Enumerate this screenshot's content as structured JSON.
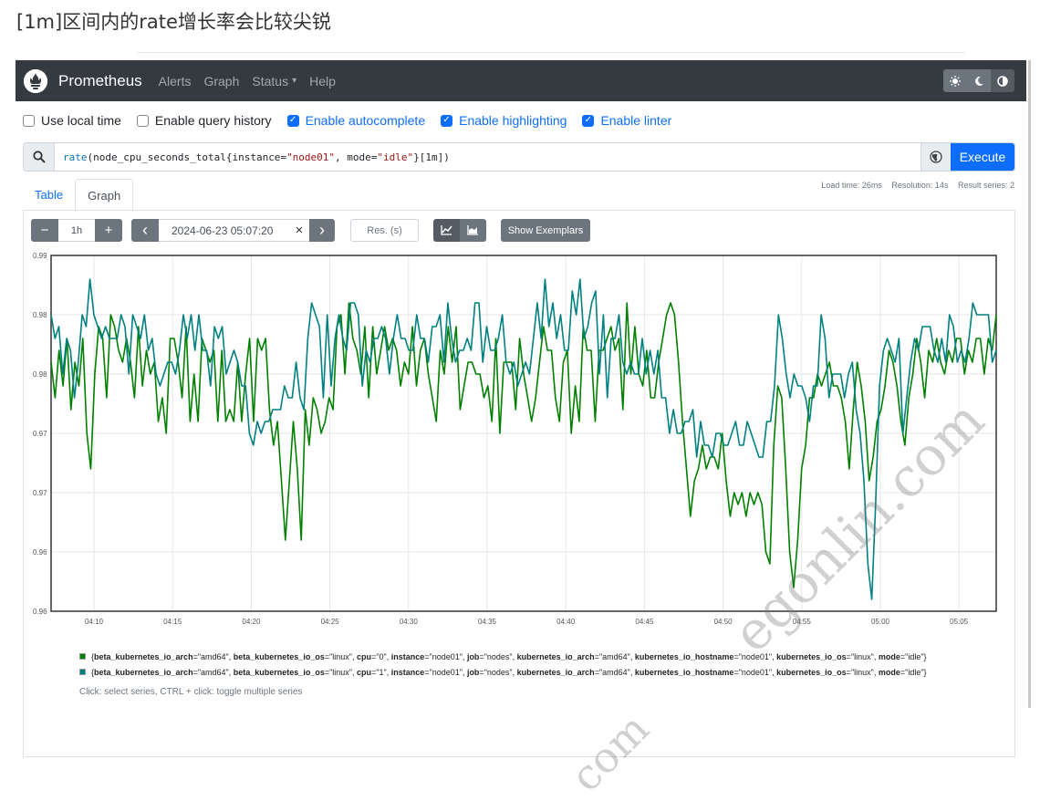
{
  "heading": "[1m]区间内的rate增长率会比较尖锐",
  "navbar": {
    "brand": "Prometheus",
    "links": [
      "Alerts",
      "Graph",
      "Status",
      "Help"
    ],
    "status_caret": "▾",
    "theme_icons": [
      "sun-icon",
      "moon-icon",
      "contrast-icon"
    ]
  },
  "options": [
    {
      "label": "Use local time",
      "checked": false
    },
    {
      "label": "Enable query history",
      "checked": false
    },
    {
      "label": "Enable autocomplete",
      "checked": true
    },
    {
      "label": "Enable highlighting",
      "checked": true
    },
    {
      "label": "Enable linter",
      "checked": true
    }
  ],
  "query": {
    "fn": "rate",
    "metric": "node_cpu_seconds_total",
    "label1_key": "instance",
    "label1_val": "\"node01\"",
    "label2_key": "mode",
    "label2_val": "\"idle\"",
    "range": "[1m]",
    "execute_label": "Execute"
  },
  "stats": {
    "load_time": "Load time: 26ms",
    "resolution": "Resolution: 14s",
    "result_series": "Result series: 2"
  },
  "tabs": [
    "Table",
    "Graph"
  ],
  "controls": {
    "minus": "−",
    "range": "1h",
    "plus": "+",
    "prev": "‹",
    "datetime": "2024-06-23 05:07:20",
    "clear": "×",
    "next": "›",
    "res_placeholder": "Res. (s)",
    "exemplars": "Show Exemplars"
  },
  "chart_data": {
    "type": "line",
    "x_ticks": [
      "04:10",
      "04:15",
      "04:20",
      "04:25",
      "04:30",
      "04:35",
      "04:40",
      "04:45",
      "04:50",
      "04:55",
      "05:00",
      "05:05"
    ],
    "y_ticks": [
      "0.99",
      "0.98",
      "0.98",
      "0.97",
      "0.97",
      "0.96",
      "0.96"
    ],
    "ylim": [
      0.96,
      0.99
    ],
    "grid": true,
    "series": [
      {
        "color": "#008000",
        "values": [
          0.981,
          0.978,
          0.982,
          0.979,
          0.983,
          0.977,
          0.981,
          0.979,
          0.983,
          0.975,
          0.972,
          0.98,
          0.984,
          0.983,
          0.978,
          0.985,
          0.984,
          0.982,
          0.981,
          0.983,
          0.981,
          0.978,
          0.984,
          0.979,
          0.982,
          0.98,
          0.981,
          0.976,
          0.978,
          0.975,
          0.983,
          0.983,
          0.981,
          0.978,
          0.984,
          0.976,
          0.98,
          0.976,
          0.983,
          0.982,
          0.981,
          0.982,
          0.976,
          0.982,
          0.976,
          0.977,
          0.976,
          0.981,
          0.976,
          0.98,
          0.983,
          0.976,
          0.983,
          0.982,
          0.983,
          0.977,
          0.974,
          0.976,
          0.971,
          0.966,
          0.971,
          0.976,
          0.972,
          0.966,
          0.977,
          0.974,
          0.978,
          0.977,
          0.975,
          0.976,
          0.978,
          0.977,
          0.984,
          0.985,
          0.98,
          0.986,
          0.983,
          0.982,
          0.98,
          0.984,
          0.978,
          0.984,
          0.98,
          0.982,
          0.984,
          0.982,
          0.983,
          0.982,
          0.979,
          0.981,
          0.98,
          0.984,
          0.979,
          0.982,
          0.983,
          0.98,
          0.978,
          0.976,
          0.982,
          0.98,
          0.984,
          0.981,
          0.984,
          0.977,
          0.979,
          0.981,
          0.981,
          0.98,
          0.98,
          0.978,
          0.979,
          0.976,
          0.983,
          0.975,
          0.981,
          0.981,
          0.981,
          0.977,
          0.983,
          0.98,
          0.978,
          0.976,
          0.978,
          0.981,
          0.984,
          0.982,
          0.982,
          0.978,
          0.976,
          0.981,
          0.982,
          0.975,
          0.979,
          0.976,
          0.984,
          0.982,
          0.982,
          0.976,
          0.982,
          0.982,
          0.983,
          0.984,
          0.982,
          0.983,
          0.977,
          0.986,
          0.98,
          0.984,
          0.98,
          0.979,
          0.982,
          0.978,
          0.978,
          0.981,
          0.983,
          0.985,
          0.986,
          0.985,
          0.981,
          0.976,
          0.972,
          0.968,
          0.971,
          0.972,
          0.974,
          0.972,
          0.973,
          0.973,
          0.972,
          0.975,
          0.971,
          0.968,
          0.97,
          0.969,
          0.97,
          0.968,
          0.97,
          0.969,
          0.97,
          0.969,
          0.965,
          0.964,
          0.974,
          0.979,
          0.978,
          0.972,
          0.965,
          0.962,
          0.966,
          0.972,
          0.974,
          0.978,
          0.978,
          0.98,
          0.979,
          0.98,
          0.981,
          0.979,
          0.979,
          0.978,
          0.976,
          0.972,
          0.977,
          0.981,
          0.979,
          0.976,
          0.971,
          0.973,
          0.976,
          0.977,
          0.979,
          0.982,
          0.981,
          0.979,
          0.976,
          0.974,
          0.978,
          0.98,
          0.983,
          0.981,
          0.978,
          0.982,
          0.981,
          0.983,
          0.981,
          0.98,
          0.982,
          0.981,
          0.983,
          0.983,
          0.98,
          0.982,
          0.981,
          0.983,
          0.983,
          0.98,
          0.983,
          0.982,
          0.985
        ]
      },
      {
        "color": "#008080",
        "values": [
          0.985,
          0.983,
          0.984,
          0.98,
          0.983,
          0.982,
          0.978,
          0.981,
          0.985,
          0.984,
          0.988,
          0.985,
          0.984,
          0.983,
          0.984,
          0.983,
          0.983,
          0.983,
          0.985,
          0.984,
          0.98,
          0.985,
          0.984,
          0.983,
          0.985,
          0.982,
          0.983,
          0.98,
          0.979,
          0.98,
          0.981,
          0.981,
          0.98,
          0.982,
          0.985,
          0.983,
          0.985,
          0.982,
          0.985,
          0.982,
          0.982,
          0.979,
          0.984,
          0.983,
          0.984,
          0.98,
          0.981,
          0.982,
          0.981,
          0.979,
          0.979,
          0.975,
          0.974,
          0.976,
          0.975,
          0.976,
          0.976,
          0.977,
          0.977,
          0.977,
          0.979,
          0.978,
          0.978,
          0.981,
          0.978,
          0.977,
          0.983,
          0.986,
          0.985,
          0.984,
          0.978,
          0.985,
          0.979,
          0.983,
          0.985,
          0.983,
          0.982,
          0.986,
          0.986,
          0.985,
          0.979,
          0.982,
          0.981,
          0.983,
          0.983,
          0.984,
          0.983,
          0.98,
          0.983,
          0.985,
          0.983,
          0.983,
          0.982,
          0.982,
          0.985,
          0.983,
          0.983,
          0.981,
          0.984,
          0.984,
          0.985,
          0.981,
          0.986,
          0.983,
          0.981,
          0.982,
          0.982,
          0.983,
          0.982,
          0.986,
          0.986,
          0.981,
          0.984,
          0.982,
          0.982,
          0.983,
          0.985,
          0.981,
          0.98,
          0.981,
          0.979,
          0.98,
          0.981,
          0.98,
          0.983,
          0.986,
          0.983,
          0.988,
          0.984,
          0.986,
          0.983,
          0.985,
          0.982,
          0.982,
          0.987,
          0.985,
          0.988,
          0.983,
          0.984,
          0.986,
          0.987,
          0.98,
          0.985,
          0.978,
          0.983,
          0.983,
          0.985,
          0.981,
          0.98,
          0.981,
          0.98,
          0.98,
          0.983,
          0.98,
          0.982,
          0.98,
          0.982,
          0.978,
          0.978,
          0.975,
          0.977,
          0.975,
          0.975,
          0.976,
          0.976,
          0.977,
          0.973,
          0.976,
          0.974,
          0.974,
          0.973,
          0.975,
          0.975,
          0.974,
          0.974,
          0.975,
          0.976,
          0.974,
          0.974,
          0.976,
          0.975,
          0.974,
          0.973,
          0.973,
          0.976,
          0.976,
          0.979,
          0.985,
          0.983,
          0.98,
          0.978,
          0.98,
          0.979,
          0.979,
          0.978,
          0.976,
          0.979,
          0.979,
          0.985,
          0.983,
          0.978,
          0.98,
          0.98,
          0.98,
          0.978,
          0.98,
          0.981,
          0.977,
          0.975,
          0.971,
          0.964,
          0.961,
          0.969,
          0.979,
          0.982,
          0.983,
          0.982,
          0.981,
          0.983,
          0.975,
          0.978,
          0.981,
          0.983,
          0.982,
          0.984,
          0.984,
          0.984,
          0.982,
          0.981,
          0.983,
          0.981,
          0.985,
          0.984,
          0.981,
          0.982,
          0.981,
          0.983,
          0.986,
          0.985,
          0.985,
          0.985,
          0.985,
          0.981,
          0.982
        ]
      }
    ]
  },
  "legend": [
    {
      "color": "#008000",
      "open": "{",
      "parts": [
        [
          "beta_kubernetes_io_arch",
          "\"amd64\""
        ],
        [
          "beta_kubernetes_io_os",
          "\"linux\""
        ],
        [
          "cpu",
          "\"0\""
        ],
        [
          "instance",
          "\"node01\""
        ],
        [
          "job",
          "\"nodes\""
        ],
        [
          "kubernetes_io_arch",
          "\"amd64\""
        ],
        [
          "kubernetes_io_hostname",
          "\"node01\""
        ],
        [
          "kubernetes_io_os",
          "\"linux\""
        ],
        [
          "mode",
          "\"idle\""
        ]
      ],
      "close": "}"
    },
    {
      "color": "#008080",
      "open": "{",
      "parts": [
        [
          "beta_kubernetes_io_arch",
          "\"amd64\""
        ],
        [
          "beta_kubernetes_io_os",
          "\"linux\""
        ],
        [
          "cpu",
          "\"1\""
        ],
        [
          "instance",
          "\"node01\""
        ],
        [
          "job",
          "\"nodes\""
        ],
        [
          "kubernetes_io_arch",
          "\"amd64\""
        ],
        [
          "kubernetes_io_hostname",
          "\"node01\""
        ],
        [
          "kubernetes_io_os",
          "\"linux\""
        ],
        [
          "mode",
          "\"idle\""
        ]
      ],
      "close": "}"
    }
  ],
  "legend_hint": "Click: select series, CTRL + click: toggle multiple series",
  "watermarks": [
    "egonlin.com",
    "com"
  ]
}
